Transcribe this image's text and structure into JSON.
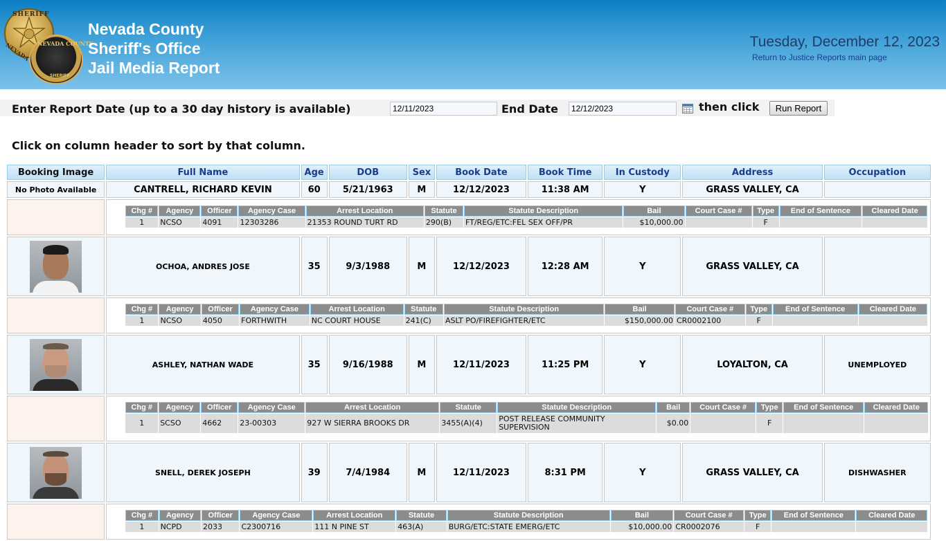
{
  "header": {
    "title_line1": "Nevada County",
    "title_line2": "Sheriff's Office",
    "title_line3": "Jail Media Report",
    "date": "Tuesday, December 12, 2023",
    "return_link": "Return to Justice Reports main page",
    "badge_star_text": "SHERIFF",
    "badge_side_text": "NEVADA",
    "badge_round_text": "NEVADA COUNTY",
    "badge_round_sub": "SHERIFF"
  },
  "form": {
    "report_date_label": "Enter Report Date (up to a 30 day history is available)",
    "report_date_value": "12/11/2023",
    "end_date_label": "End Date",
    "end_date_value": "12/12/2023",
    "then_click_label": "then click",
    "run_button": "Run Report"
  },
  "sort_hint": "Click on column header to sort by that column.",
  "columns": [
    "Booking Image",
    "Full Name",
    "Age",
    "DOB",
    "Sex",
    "Book Date",
    "Book Time",
    "In Custody",
    "Address",
    "Occupation"
  ],
  "charge_columns_a": [
    "Chg #",
    "Agency",
    "Officer",
    "Agency Case",
    "Arrest Location",
    "Statute",
    "Statute Description",
    "Bail",
    "Court Case #",
    "Type",
    "End of Sentence",
    "Cleared Date"
  ],
  "inmates": [
    {
      "photo": "No Photo Available",
      "name": "CANTRELL, RICHARD KEVIN",
      "age": "60",
      "dob": "5/21/1963",
      "sex": "M",
      "book_date": "12/12/2023",
      "book_time": "11:38 AM",
      "in_custody": "Y",
      "address": "GRASS VALLEY, CA",
      "occupation": "",
      "charge": {
        "chg": "1",
        "agency": "NCSO",
        "officer": "4091",
        "case": "12303286",
        "location": "21353 ROUND TURT RD",
        "statute": "290(B)",
        "description": "FT/REG/ETC:FEL SEX OFF/PR",
        "bail": "$10,000.00",
        "court_case": "",
        "type": "F",
        "end": "",
        "cleared": ""
      }
    },
    {
      "photo": "mugshot",
      "name": "OCHOA, ANDRES JOSE",
      "age": "35",
      "dob": "9/3/1988",
      "sex": "M",
      "book_date": "12/12/2023",
      "book_time": "12:28 AM",
      "in_custody": "Y",
      "address": "GRASS VALLEY, CA",
      "occupation": "",
      "charge": {
        "chg": "1",
        "agency": "NCSO",
        "officer": "4050",
        "case": "FORTHWITH",
        "location": "NC COURT HOUSE",
        "statute": "241(C)",
        "description": "ASLT PO/FIREFIGHTER/ETC",
        "bail": "$150,000.00",
        "court_case": "CR0002100",
        "type": "F",
        "end": "",
        "cleared": ""
      }
    },
    {
      "photo": "mugshot",
      "name": "ASHLEY, NATHAN WADE",
      "age": "35",
      "dob": "9/16/1988",
      "sex": "M",
      "book_date": "12/11/2023",
      "book_time": "11:25 PM",
      "in_custody": "Y",
      "address": "LOYALTON, CA",
      "occupation": "UNEMPLOYED",
      "charge": {
        "chg": "1",
        "agency": "SCSO",
        "officer": "4662",
        "case": "23-00303",
        "location": "927 W SIERRA BROOKS DR",
        "statute": "3455(A)(4)",
        "description": "POST RELEASE COMMUNITY SUPERVISION",
        "bail": "$0.00",
        "court_case": "",
        "type": "F",
        "end": "",
        "cleared": ""
      }
    },
    {
      "photo": "mugshot",
      "name": "SNELL, DEREK JOSEPH",
      "age": "39",
      "dob": "7/4/1984",
      "sex": "M",
      "book_date": "12/11/2023",
      "book_time": "8:31 PM",
      "in_custody": "Y",
      "address": "GRASS VALLEY, CA",
      "occupation": "DISHWASHER",
      "charge": {
        "chg": "1",
        "agency": "NCPD",
        "officer": "2033",
        "case": "C2300716",
        "location": "111 N PINE ST",
        "statute": "463(A)",
        "description": "BURG/ETC:STATE EMERG/ETC",
        "bail": "$10,000.00",
        "court_case": "CR0002076",
        "type": "F",
        "end": "",
        "cleared": ""
      }
    }
  ],
  "colors": {
    "header_top": "#0b7fc4",
    "header_bottom": "#7cc2ea",
    "link": "#1a3c8a",
    "row_bg": "#f0f7fc",
    "charge_left_bg": "#fdf2ec",
    "charge_header_bg": "#8c8c8c"
  }
}
